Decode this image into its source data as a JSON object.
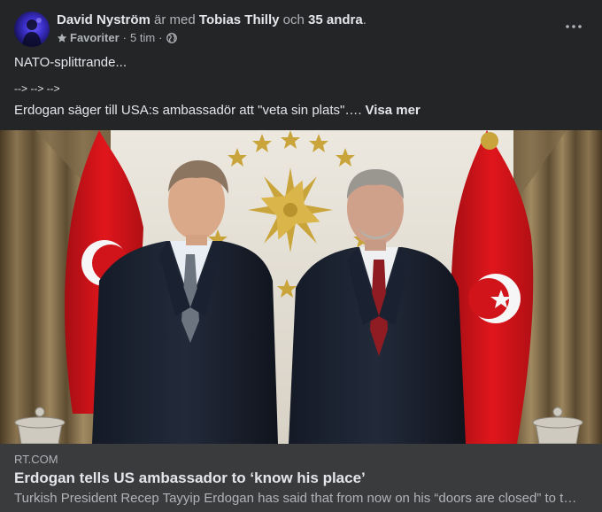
{
  "post": {
    "author": "David Nyström",
    "with_text": "är med",
    "tagged": "Tobias Thilly",
    "and_text": "och",
    "others": "35 andra",
    "period": ".",
    "audience": "Favoriter",
    "time": "5 tim",
    "dot": "·",
    "audience_icon": "globe-icon",
    "more_icon": "more-options-icon",
    "lines": [
      "NATO-splittrande...",
      "--> --> -->",
      "Erdogan säger till USA:s ambassadör att \"veta sin plats\"…."
    ],
    "see_more": "Visa mer"
  },
  "link": {
    "domain": "RT.COM",
    "title": "Erdogan tells US ambassador to ‘know his place’",
    "description": "Turkish President Recep Tayyip Erdogan has said that from now on his “doors are closed” to the US ambassador"
  },
  "colors": {
    "background": "#242526",
    "link_footer": "#3a3b3c",
    "text_primary": "#e4e6eb",
    "text_secondary": "#b0b3b8",
    "flag_red": "#d7141a"
  }
}
